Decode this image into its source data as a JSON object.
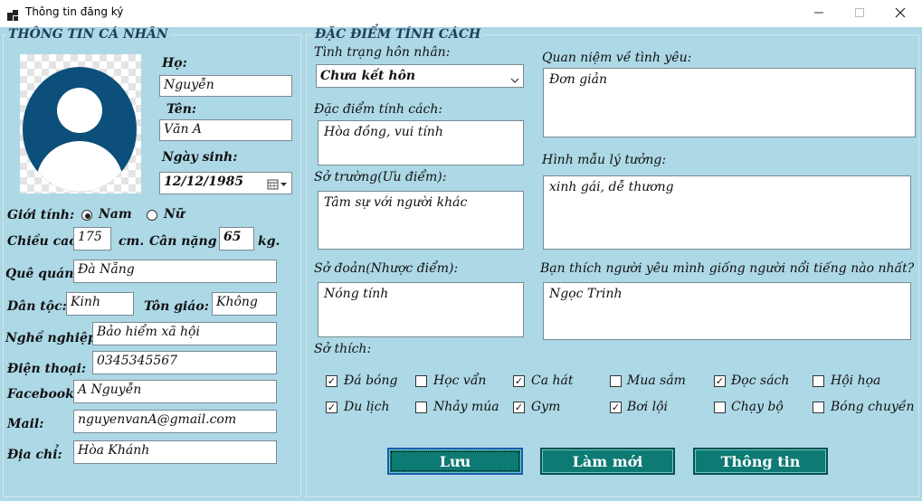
{
  "window": {
    "title": "Thông tin đăng ký",
    "icon": "app-icon",
    "minimize_icon": "minimize-icon",
    "maximize_icon": "maximize-icon",
    "close_icon": "close-icon"
  },
  "personal": {
    "group_title": "THÔNG TIN CÁ NHÂN",
    "avatar_icon": "user-avatar-icon",
    "ho_label": "Họ:",
    "ho_value": "Nguyễn",
    "ten_label": "Tên:",
    "ten_value": "Văn A",
    "ngaysinh_label": "Ngày sinh:",
    "ngaysinh_value": "12/12/1985",
    "calendar_icon": "calendar-dropdown-icon",
    "gioitinh_label": "Giới tính:",
    "gioitinh_options": [
      "Nam",
      "Nữ"
    ],
    "gioitinh_selected": "Nam",
    "chieucao_label": "Chiều cao:",
    "chieucao_value": "175",
    "chieucao_unit": "cm.",
    "cannang_label": "Cân nặng",
    "cannang_value": "65",
    "cannang_unit": "kg.",
    "quequan_label": "Quê quán:",
    "quequan_value": "Đà Nẵng",
    "dantoc_label": "Dân tộc:",
    "dantoc_value": "Kinh",
    "tongiao_label": "Tôn giáo:",
    "tongiao_value": "Không",
    "nghenghiep_label": "Nghề nghiệp:",
    "nghenghiep_value": "Bảo hiểm xã hội",
    "dienthoai_label": "Điện thoại:",
    "dienthoai_value": "0345345567",
    "facebook_label": "Facebook:",
    "facebook_value": "A Nguyễn",
    "mail_label": "Mail:",
    "mail_value": "nguyenvanA@gmail.com",
    "diachi_label": "Địa chỉ:",
    "diachi_value": "Hòa Khánh"
  },
  "personality": {
    "group_title": "ĐẶC ĐIỂM TÍNH CÁCH",
    "honnhan_label": "Tình trạng hôn nhân:",
    "honnhan_value": "Chưa kết hôn",
    "dropdown_icon": "chevron-down-icon",
    "dacdiem_label": "Đặc điểm tính cách:",
    "dacdiem_value": "Hòa đồng, vui tính",
    "sotruong_label": "Sở trường(Ưu điểm):",
    "sotruong_value": "Tâm sự với người khác",
    "sodoan_label": "Sở đoản(Nhược điểm):",
    "sodoan_value": "Nóng tính",
    "quanniem_label": "Quan niệm về tình yêu:",
    "quanniem_value": "Đơn giản",
    "hinhmau_label": "Hình mẫu lý tưởng:",
    "hinhmau_value": "xinh gái, dễ thương",
    "banthich_label": "Bạn thích người yêu mình giống người nổi tiếng nào nhất?",
    "banthich_value": "Ngọc Trinh",
    "sothich_label": "Sở thích:",
    "hobbies": [
      {
        "label": "Đá bóng",
        "checked": true
      },
      {
        "label": "Học vẩn",
        "checked": false
      },
      {
        "label": "Ca hát",
        "checked": true
      },
      {
        "label": "Mua sắm",
        "checked": false
      },
      {
        "label": "Đọc sách",
        "checked": true
      },
      {
        "label": "Hội họa",
        "checked": false
      },
      {
        "label": "Du lịch",
        "checked": true
      },
      {
        "label": "Nhảy múa",
        "checked": false
      },
      {
        "label": "Gym",
        "checked": true
      },
      {
        "label": "Bơi lội",
        "checked": true
      },
      {
        "label": "Chạy bộ",
        "checked": false
      },
      {
        "label": "Bóng chuyền",
        "checked": false
      }
    ]
  },
  "buttons": {
    "luu": "Lưu",
    "lammoi": "Làm mới",
    "thongtin": "Thông tin"
  },
  "colors": {
    "background": "#add8e6",
    "button": "#0e7a74",
    "avatar": "#0b4f7a"
  }
}
